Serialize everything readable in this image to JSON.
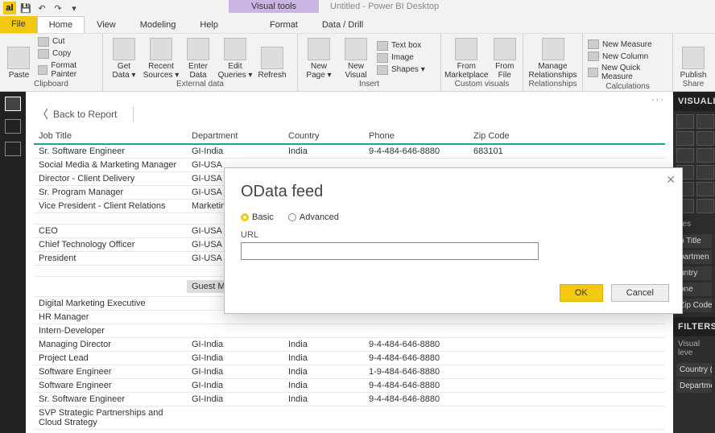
{
  "title": {
    "visualTools": "Visual tools",
    "doc": "Untitled - Power BI Desktop"
  },
  "menu": {
    "file": "File",
    "home": "Home",
    "view": "View",
    "modeling": "Modeling",
    "help": "Help",
    "format": "Format",
    "dataDrill": "Data / Drill"
  },
  "ribbon": {
    "clipboard": {
      "label": "Clipboard",
      "paste": "Paste",
      "cut": "Cut",
      "copy": "Copy",
      "formatPainter": "Format Painter"
    },
    "external": {
      "label": "External data",
      "getData": "Get\nData ▾",
      "recent": "Recent\nSources ▾",
      "enter": "Enter\nData",
      "edit": "Edit\nQueries ▾",
      "refresh": "Refresh"
    },
    "insert": {
      "label": "Insert",
      "newPage": "New\nPage ▾",
      "newVisual": "New\nVisual",
      "textbox": "Text box",
      "image": "Image",
      "shapes": "Shapes ▾"
    },
    "custom": {
      "label": "Custom visuals",
      "fromMarket": "From\nMarketplace",
      "fromFile": "From\nFile"
    },
    "rel": {
      "label": "Relationships",
      "manage": "Manage\nRelationships"
    },
    "calc": {
      "label": "Calculations",
      "measure": "New Measure",
      "column": "New Column",
      "quick": "New Quick Measure"
    },
    "share": {
      "label": "Share",
      "publish": "Publish"
    }
  },
  "back": "Back to Report",
  "table": {
    "headers": {
      "job": "Job Title",
      "dept": "Department",
      "country": "Country",
      "phone": "Phone",
      "zip": "Zip Code"
    },
    "rows": [
      {
        "job": "Sr. Software Engineer",
        "dept": "GI-India",
        "country": "India",
        "phone": "9-4-484-646-8880",
        "zip": "683101"
      },
      {
        "job": "Social Media & Marketing Manager",
        "dept": "GI-USA",
        "country": "",
        "phone": "",
        "zip": ""
      },
      {
        "job": "Director - Client Delivery",
        "dept": "GI-USA",
        "country": "",
        "phone": "",
        "zip": ""
      },
      {
        "job": "Sr. Program Manager",
        "dept": "GI-USA",
        "country": "",
        "phone": "",
        "zip": ""
      },
      {
        "job": "Vice President - Client Relations",
        "dept": "Marketing",
        "country": "",
        "phone": "",
        "zip": ""
      },
      {
        "job": "",
        "dept": "",
        "country": "",
        "phone": "",
        "zip": ""
      },
      {
        "job": "CEO",
        "dept": "GI-USA",
        "country": "",
        "phone": "",
        "zip": ""
      },
      {
        "job": "Chief Technology Officer",
        "dept": "GI-USA",
        "country": "",
        "phone": "",
        "zip": ""
      },
      {
        "job": "President",
        "dept": "GI-USA",
        "country": "",
        "phone": "",
        "zip": ""
      },
      {
        "job": "",
        "dept": "",
        "country": "",
        "phone": "",
        "zip": ""
      },
      {
        "job": "Digital Marketing Executive",
        "dept": "",
        "country": "",
        "phone": "",
        "zip": ""
      },
      {
        "job": "HR Manager",
        "dept": "",
        "country": "",
        "phone": "",
        "zip": ""
      },
      {
        "job": "Intern-Developer",
        "dept": "",
        "country": "",
        "phone": "",
        "zip": ""
      },
      {
        "job": "Managing Director",
        "dept": "GI-India",
        "country": "India",
        "phone": "9-4-484-646-8880",
        "zip": ""
      },
      {
        "job": "Project Lead",
        "dept": "GI-India",
        "country": "India",
        "phone": "9-4-484-646-8880",
        "zip": ""
      },
      {
        "job": "Software Engineer",
        "dept": "GI-India",
        "country": "India",
        "phone": "1-9-484-646-8880",
        "zip": ""
      },
      {
        "job": "Software Engineer",
        "dept": "GI-India",
        "country": "India",
        "phone": "9-4-484-646-8880",
        "zip": ""
      },
      {
        "job": "Sr. Software Engineer",
        "dept": "GI-India",
        "country": "India",
        "phone": "9-4-484-646-8880",
        "zip": ""
      },
      {
        "job": "SVP Strategic Partnerships and Cloud Strategy",
        "dept": "",
        "country": "",
        "phone": "",
        "zip": ""
      }
    ],
    "guest": "Guest Migr"
  },
  "right": {
    "viz": "VISUALIZ",
    "values": "ues",
    "fields": [
      "b Title",
      "partmen",
      "untry",
      "one",
      "Zip Code"
    ],
    "filters": "FILTERS",
    "filterLabel": "Visual leve",
    "filterItems": [
      "Country (A",
      "Departme"
    ]
  },
  "modal": {
    "title": "OData feed",
    "basic": "Basic",
    "advanced": "Advanced",
    "url": "URL",
    "ok": "OK",
    "cancel": "Cancel"
  }
}
